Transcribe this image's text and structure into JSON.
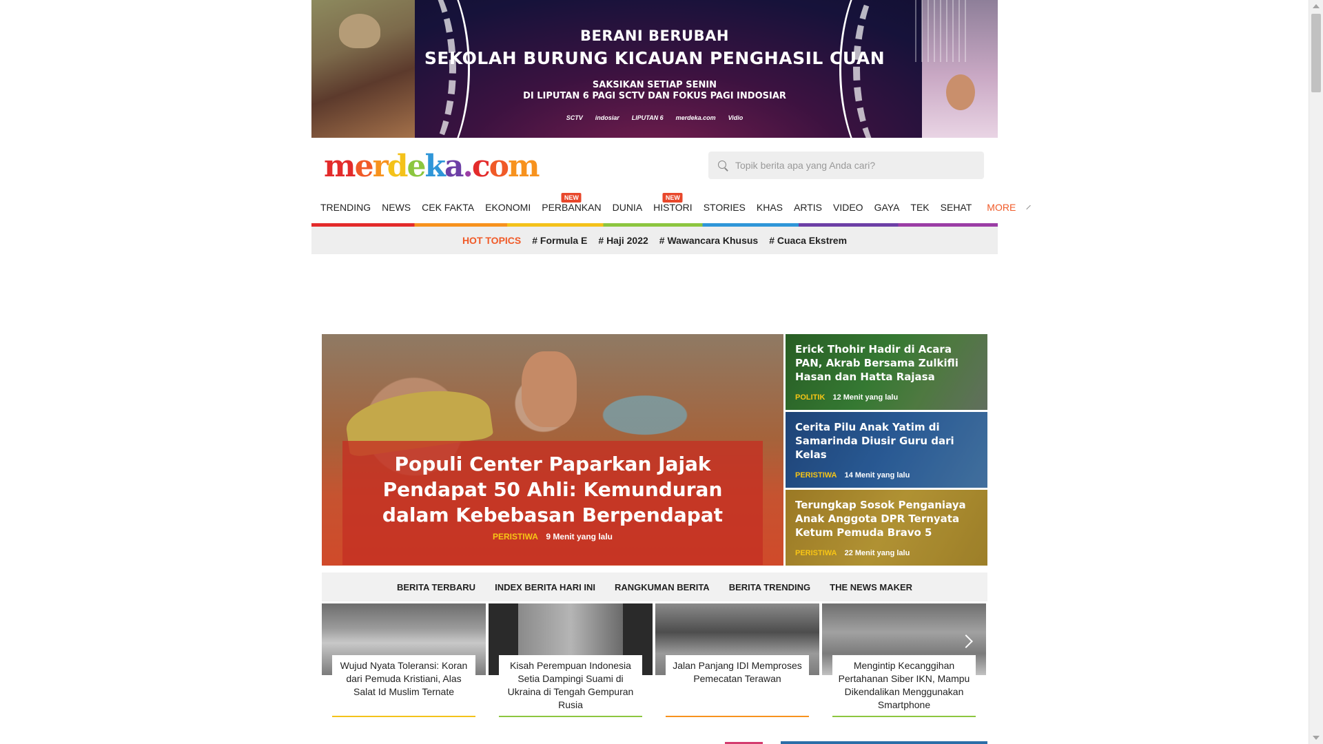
{
  "banner": {
    "line1": "BERANI BERUBAH",
    "line2": "SEKOLAH BURUNG KICAUAN PENGHASIL CUAN",
    "line3": "SAKSIKAN SETIAP SENIN",
    "line4": "DI LIPUTAN 6 PAGI SCTV DAN FOKUS PAGI INDOSIAR",
    "logos": [
      "SCTV",
      "indosiar",
      "LIPUTAN 6",
      "merdeka.com",
      "Vidio"
    ]
  },
  "header": {
    "logo_letters": [
      "m",
      "e",
      "r",
      "d",
      "e",
      "k",
      "a",
      ".",
      "c",
      "o",
      "m"
    ],
    "logo_colors": [
      "#e32b2b",
      "#f05a28",
      "#f7921e",
      "#f4c21a",
      "#8cc63f",
      "#2f96d8",
      "#6d3fa6",
      "#9b3da5",
      "#e32b2b",
      "#f05a28",
      "#f7921e"
    ]
  },
  "search": {
    "placeholder": "Topik berita apa yang Anda cari?",
    "icon": "search-icon"
  },
  "nav": {
    "items": [
      {
        "label": "TRENDING",
        "badge": ""
      },
      {
        "label": "NEWS",
        "badge": ""
      },
      {
        "label": "CEK FAKTA",
        "badge": ""
      },
      {
        "label": "EKONOMI",
        "badge": ""
      },
      {
        "label": "PERBANKAN",
        "badge": "NEW"
      },
      {
        "label": "DUNIA",
        "badge": ""
      },
      {
        "label": "HISTORI",
        "badge": "NEW"
      },
      {
        "label": "STORIES",
        "badge": ""
      },
      {
        "label": "KHAS",
        "badge": ""
      },
      {
        "label": "ARTIS",
        "badge": ""
      },
      {
        "label": "VIDEO",
        "badge": ""
      },
      {
        "label": "GAYA",
        "badge": ""
      },
      {
        "label": "TEK",
        "badge": ""
      },
      {
        "label": "SEHAT",
        "badge": ""
      }
    ],
    "more_label": "MORE"
  },
  "hot_topics": {
    "label": "HOT TOPICS",
    "topics": [
      "# Formula E",
      "# Haji 2022",
      "# Wawancara Khusus",
      "# Cuaca Ekstrem"
    ]
  },
  "headline": {
    "main": {
      "title": "Populi Center Paparkan Jajak Pendapat 50 Ahli: Kemunduran dalam Kebebasan Berpendapat",
      "category": "PERISTIWA",
      "time": "9 Menit yang lalu"
    },
    "side": [
      {
        "title": "Erick Thohir Hadir di Acara PAN, Akrab Bersama Zulkifli Hasan dan Hatta Rajasa",
        "category": "POLITIK",
        "time": "12 Menit yang lalu"
      },
      {
        "title": "Cerita Pilu Anak Yatim di Samarinda Diusir Guru dari Kelas",
        "category": "PERISTIWA",
        "time": "14 Menit yang lalu"
      },
      {
        "title": "Terungkap Sosok Penganiaya Anak Anggota DPR Ternyata Ketum Pemuda Bravo 5",
        "category": "PERISTIWA",
        "time": "22 Menit yang lalu"
      }
    ]
  },
  "tabs": [
    "BERITA TERBARU",
    "INDEX BERITA HARI INI",
    "RANGKUMAN BERITA",
    "BERITA TRENDING",
    "THE NEWS MAKER"
  ],
  "cards": [
    {
      "title": "Wujud Nyata Toleransi: Koran dari Pemuda Kristiani, Alas Salat Id Muslim Ternate",
      "accent": "#f4c21a"
    },
    {
      "title": "Kisah Perempuan Indonesia Setia Dampingi Suami di Ukraina di Tengah Gempuran Rusia",
      "accent": "#8cc63f"
    },
    {
      "title": "Jalan Panjang IDI Memproses Pemecatan Terawan",
      "accent": "#f7921e"
    },
    {
      "title": "Mengintip Kecanggihan Pertahanan Siber IKN, Mampu Dikendalikan Menggunakan Smartphone",
      "accent": "#8cc63f"
    }
  ]
}
